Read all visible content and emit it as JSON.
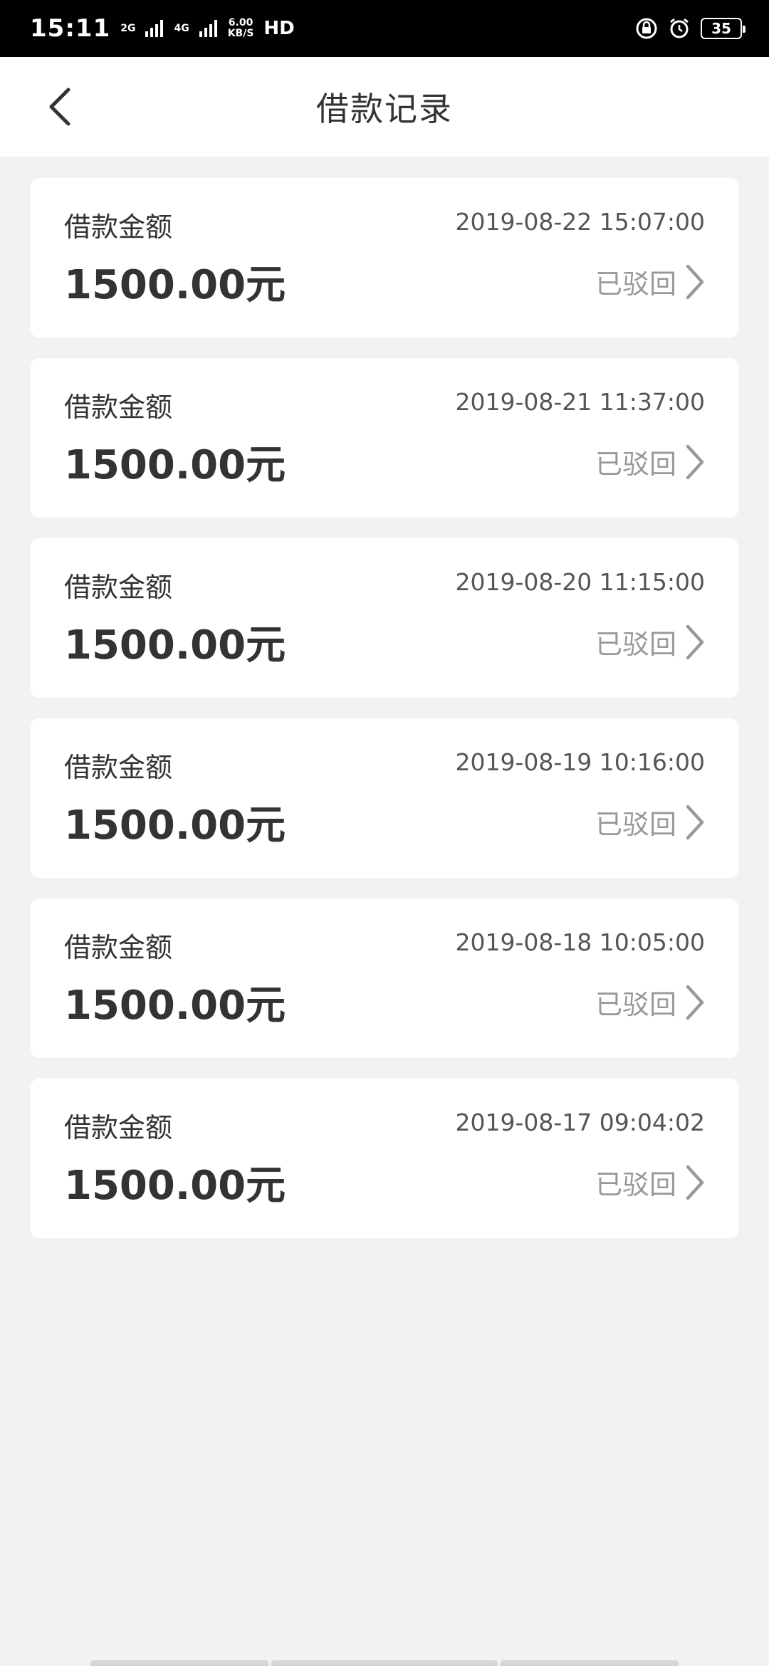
{
  "status_bar": {
    "time": "15:11",
    "net_2g": "2G",
    "net_4g": "4G",
    "speed_value": "6.00",
    "speed_unit": "KB/S",
    "hd": "HD",
    "battery": "35"
  },
  "header": {
    "title": "借款记录"
  },
  "records": [
    {
      "label": "借款金额",
      "date": "2019-08-22 15:07:00",
      "amount": "1500.00元",
      "status": "已驳回"
    },
    {
      "label": "借款金额",
      "date": "2019-08-21 11:37:00",
      "amount": "1500.00元",
      "status": "已驳回"
    },
    {
      "label": "借款金额",
      "date": "2019-08-20 11:15:00",
      "amount": "1500.00元",
      "status": "已驳回"
    },
    {
      "label": "借款金额",
      "date": "2019-08-19 10:16:00",
      "amount": "1500.00元",
      "status": "已驳回"
    },
    {
      "label": "借款金额",
      "date": "2019-08-18 10:05:00",
      "amount": "1500.00元",
      "status": "已驳回"
    },
    {
      "label": "借款金额",
      "date": "2019-08-17 09:04:02",
      "amount": "1500.00元",
      "status": "已驳回"
    }
  ],
  "colors": {
    "background": "#f2f2f2",
    "card": "#ffffff",
    "text_primary": "#333333",
    "text_secondary": "#999999"
  }
}
